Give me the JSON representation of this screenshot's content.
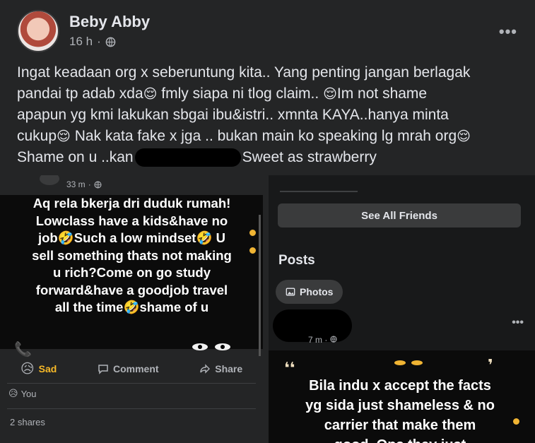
{
  "post": {
    "author": "Beby Abby",
    "time": "16 h",
    "text_lines": [
      "Ingat keadaan org x seberuntung kita.. Yang penting jangan berlagak",
      "pandai tp adab xda",
      " fmly siapa ni tlog claim.. ",
      "Im not shame",
      "apapun yg kmi lakukan sbgai ibu&istri.. xmnta KAYA..hanya minta",
      "cukup",
      " Nak kata fake x jga .. bukan main ko speaking lg mrah org",
      "Shame on u ..kan",
      "Sweet as strawberry"
    ],
    "emoji": "😌"
  },
  "left_shot": {
    "time": "33 m",
    "story_lines": [
      "Aq rela bkerja dri duduk rumah!",
      "Lowclass have a kids&have no",
      "job🤣Such a low mindset🤣 U",
      "sell something thats not making",
      "u rich?Come on go study",
      "forward&have a goodjob travel",
      "all the time🤣shame of u"
    ],
    "actions": {
      "sad": "Sad",
      "comment": "Comment",
      "share": "Share"
    },
    "reaction_text": "You",
    "shares": "2 shares"
  },
  "right_shot": {
    "see_all": "See All Friends",
    "posts_title": "Posts",
    "photos": "Photos",
    "time": "7 m",
    "story_lines": [
      "Bila indu x accept the facts",
      "yg sida just shameless & no",
      "carrier that make them",
      "good..Ops they just"
    ]
  },
  "colors": {
    "background": "#242526",
    "text": "#e4e6eb",
    "muted": "#b0b3b8",
    "accent": "#f7b928"
  }
}
